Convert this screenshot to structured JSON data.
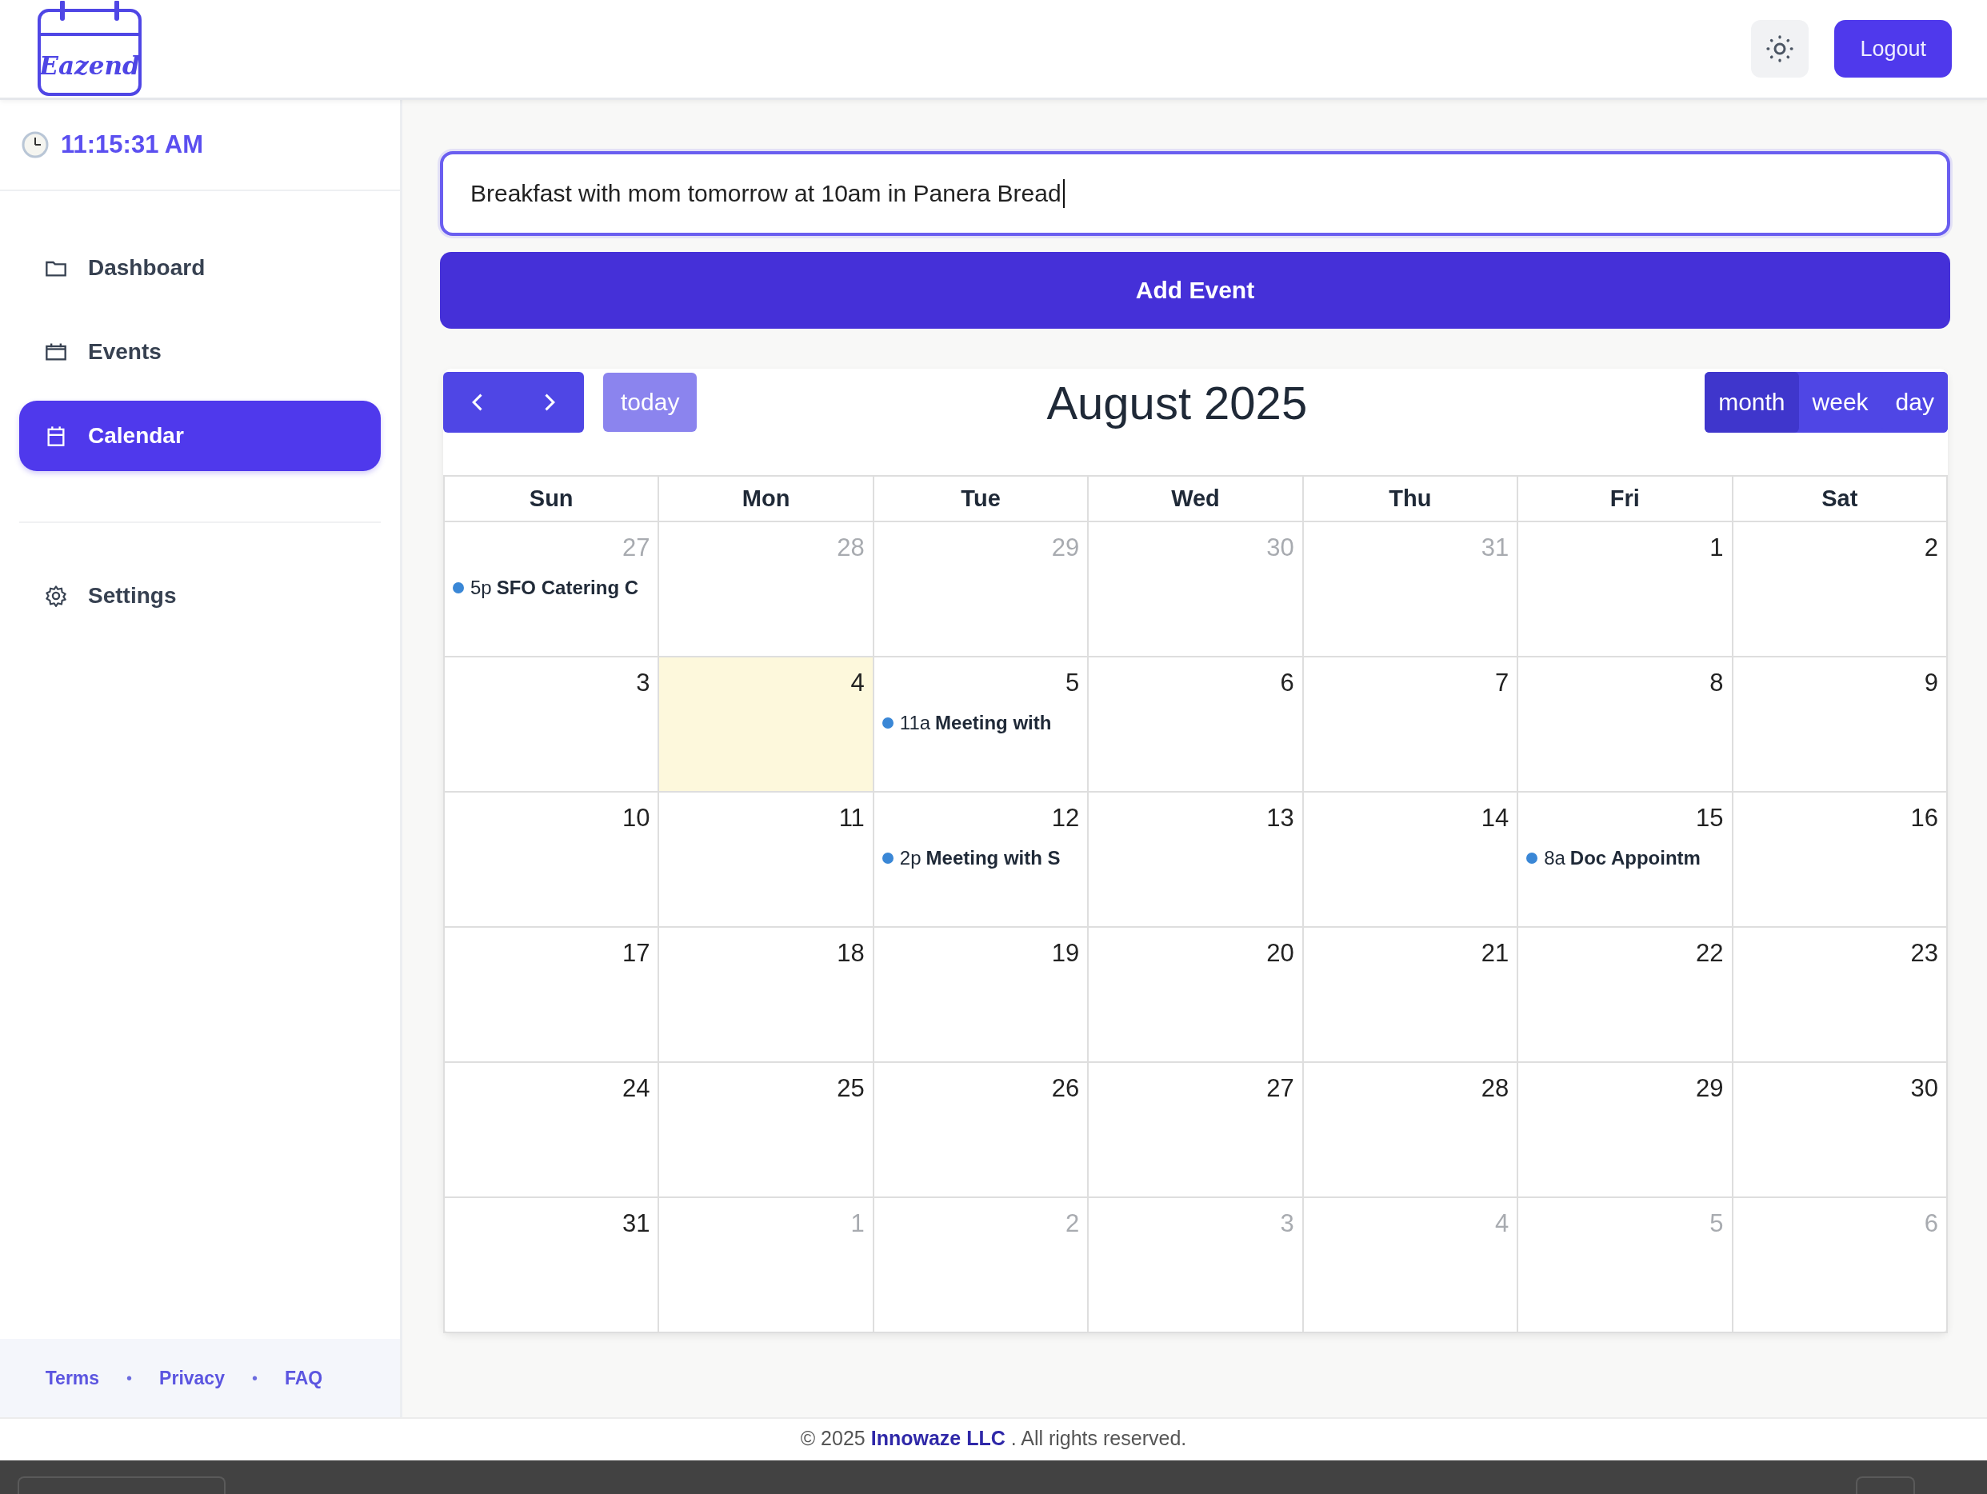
{
  "header": {
    "logo_text": "Eazend",
    "logout": "Logout"
  },
  "sidebar": {
    "clock": "11:15:31 AM",
    "sections": [
      [
        {
          "label": "Dashboard",
          "selected": false
        },
        {
          "label": "Events",
          "selected": false
        },
        {
          "label": "Calendar",
          "selected": true
        }
      ],
      [
        {
          "label": "Settings",
          "selected": false
        }
      ]
    ],
    "footer": [
      {
        "kind": "link",
        "text": "Terms"
      },
      {
        "kind": "separator",
        "text": "•"
      },
      {
        "kind": "link",
        "text": "Privacy"
      },
      {
        "kind": "separator",
        "text": "•"
      },
      {
        "kind": "link",
        "text": "FAQ"
      }
    ]
  },
  "event_input": {
    "value": "Breakfast with mom tomorrow at 10am in Panera Bread",
    "focused": true
  },
  "add_button": "Add Event",
  "calendar": {
    "today_button": {
      "label": "today",
      "disabled": true
    },
    "title": "August 2025",
    "views": [
      {
        "label": "month",
        "selected": true
      },
      {
        "label": "week",
        "selected": false
      },
      {
        "label": "day",
        "selected": false
      }
    ],
    "weekdays": [
      "Sun",
      "Mon",
      "Tue",
      "Wed",
      "Thu",
      "Fri",
      "Sat"
    ],
    "weeks": [
      [
        {
          "day": "27",
          "other_month": true,
          "today": false,
          "events": [
            {
              "time": "5p",
              "title": "SFO Catering C"
            }
          ]
        },
        {
          "day": "28",
          "other_month": true,
          "today": false
        },
        {
          "day": "29",
          "other_month": true,
          "today": false
        },
        {
          "day": "30",
          "other_month": true,
          "today": false
        },
        {
          "day": "31",
          "other_month": true,
          "today": false
        },
        {
          "day": "1",
          "other_month": false,
          "today": false
        },
        {
          "day": "2",
          "other_month": false,
          "today": false
        }
      ],
      [
        {
          "day": "3",
          "other_month": false,
          "today": false
        },
        {
          "day": "4",
          "other_month": false,
          "today": true
        },
        {
          "day": "5",
          "other_month": false,
          "today": false,
          "events": [
            {
              "time": "11a",
              "title": "Meeting with"
            }
          ]
        },
        {
          "day": "6",
          "other_month": false,
          "today": false
        },
        {
          "day": "7",
          "other_month": false,
          "today": false
        },
        {
          "day": "8",
          "other_month": false,
          "today": false
        },
        {
          "day": "9",
          "other_month": false,
          "today": false
        }
      ],
      [
        {
          "day": "10",
          "other_month": false,
          "today": false
        },
        {
          "day": "11",
          "other_month": false,
          "today": false
        },
        {
          "day": "12",
          "other_month": false,
          "today": false,
          "events": [
            {
              "time": "2p",
              "title": "Meeting with S"
            }
          ]
        },
        {
          "day": "13",
          "other_month": false,
          "today": false
        },
        {
          "day": "14",
          "other_month": false,
          "today": false
        },
        {
          "day": "15",
          "other_month": false,
          "today": false,
          "events": [
            {
              "time": "8a",
              "title": "Doc Appointm"
            }
          ]
        },
        {
          "day": "16",
          "other_month": false,
          "today": false
        }
      ],
      [
        {
          "day": "17",
          "other_month": false,
          "today": false
        },
        {
          "day": "18",
          "other_month": false,
          "today": false
        },
        {
          "day": "19",
          "other_month": false,
          "today": false
        },
        {
          "day": "20",
          "other_month": false,
          "today": false
        },
        {
          "day": "21",
          "other_month": false,
          "today": false
        },
        {
          "day": "22",
          "other_month": false,
          "today": false
        },
        {
          "day": "23",
          "other_month": false,
          "today": false
        }
      ],
      [
        {
          "day": "24",
          "other_month": false,
          "today": false
        },
        {
          "day": "25",
          "other_month": false,
          "today": false
        },
        {
          "day": "26",
          "other_month": false,
          "today": false
        },
        {
          "day": "27",
          "other_month": false,
          "today": false
        },
        {
          "day": "28",
          "other_month": false,
          "today": false
        },
        {
          "day": "29",
          "other_month": false,
          "today": false
        },
        {
          "day": "30",
          "other_month": false,
          "today": false
        }
      ],
      [
        {
          "day": "31",
          "other_month": false,
          "today": false
        },
        {
          "day": "1",
          "other_month": true,
          "today": false
        },
        {
          "day": "2",
          "other_month": true,
          "today": false
        },
        {
          "day": "3",
          "other_month": true,
          "today": false
        },
        {
          "day": "4",
          "other_month": true,
          "today": false
        },
        {
          "day": "5",
          "other_month": true,
          "today": false
        },
        {
          "day": "6",
          "other_month": true,
          "today": false
        }
      ]
    ]
  },
  "page_footer": {
    "before": "© 2025",
    "link": "Innowaze LLC",
    "after": ". All rights reserved."
  }
}
